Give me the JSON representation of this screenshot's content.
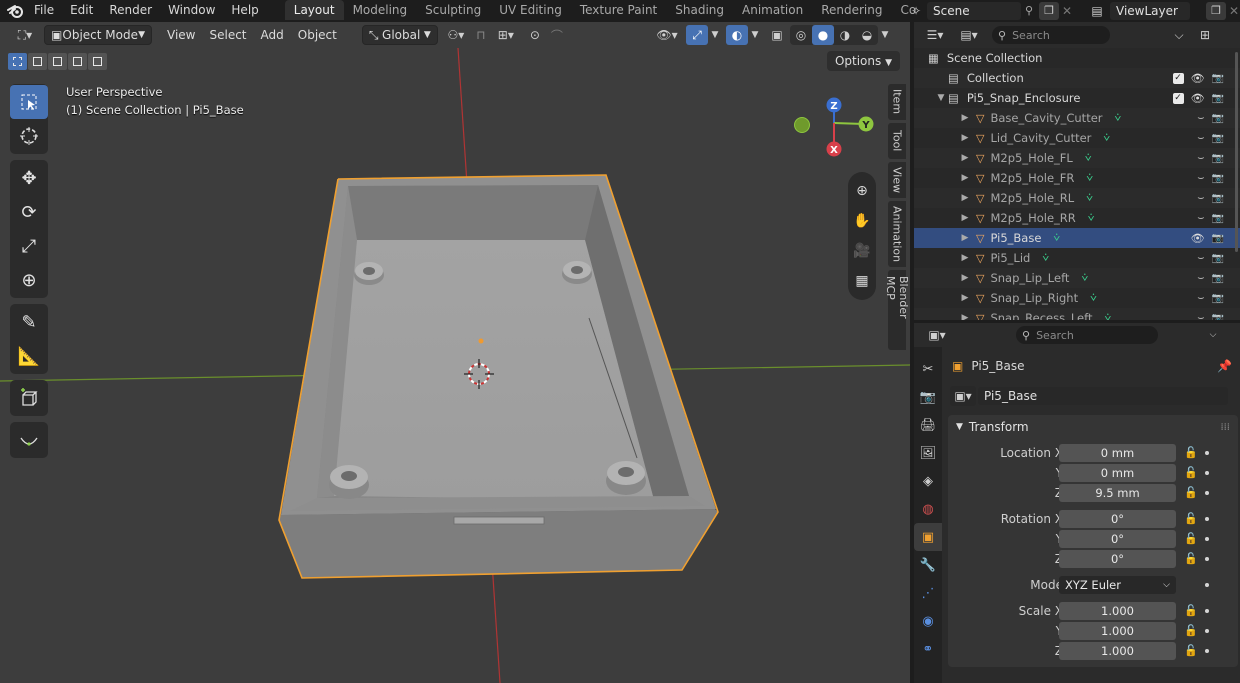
{
  "topbar": {
    "menus": [
      "File",
      "Edit",
      "Render",
      "Window",
      "Help"
    ],
    "workspaces": [
      {
        "label": "Layout",
        "active": true
      },
      {
        "label": "Modeling",
        "active": false
      },
      {
        "label": "Sculpting",
        "active": false
      },
      {
        "label": "UV Editing",
        "active": false
      },
      {
        "label": "Texture Paint",
        "active": false
      },
      {
        "label": "Shading",
        "active": false
      },
      {
        "label": "Animation",
        "active": false
      },
      {
        "label": "Rendering",
        "active": false
      },
      {
        "label": "Compositing",
        "active": false
      }
    ],
    "scene": "Scene",
    "view_layer": "ViewLayer"
  },
  "viewport": {
    "mode": "Object Mode",
    "menus": [
      "View",
      "Select",
      "Add",
      "Object"
    ],
    "orientation": "Global",
    "options_label": "Options",
    "perspective": "User Perspective",
    "collection_info": "(1) Scene Collection | Pi5_Base",
    "side_tabs": [
      "Item",
      "Tool",
      "View",
      "Animation",
      "Blender MCP"
    ],
    "gizmo": {
      "z": "Z",
      "y": "Y",
      "x": "X"
    },
    "accent": "#4772b3",
    "selection_outline": "#f0a030"
  },
  "outliner": {
    "search_placeholder": "Search",
    "rows": [
      {
        "label": "Scene Collection",
        "indent": 0,
        "kind": "scene",
        "checkbox": false,
        "visible": true
      },
      {
        "label": "Collection",
        "indent": 1,
        "kind": "collection",
        "checkbox": true,
        "visible": true
      },
      {
        "label": "Pi5_Snap_Enclosure",
        "indent": 1,
        "kind": "collection",
        "checkbox": true,
        "visible": true,
        "expanded": true
      },
      {
        "label": "Base_Cavity_Cutter",
        "indent": 2,
        "kind": "mesh",
        "dim": true
      },
      {
        "label": "Lid_Cavity_Cutter",
        "indent": 2,
        "kind": "mesh",
        "dim": true
      },
      {
        "label": "M2p5_Hole_FL",
        "indent": 2,
        "kind": "mesh",
        "dim": true
      },
      {
        "label": "M2p5_Hole_FR",
        "indent": 2,
        "kind": "mesh",
        "dim": true
      },
      {
        "label": "M2p5_Hole_RL",
        "indent": 2,
        "kind": "mesh",
        "dim": true
      },
      {
        "label": "M2p5_Hole_RR",
        "indent": 2,
        "kind": "mesh",
        "dim": true
      },
      {
        "label": "Pi5_Base",
        "indent": 2,
        "kind": "mesh",
        "selected": true
      },
      {
        "label": "Pi5_Lid",
        "indent": 2,
        "kind": "mesh",
        "dim": true
      },
      {
        "label": "Snap_Lip_Left",
        "indent": 2,
        "kind": "mesh",
        "dim": true
      },
      {
        "label": "Snap_Lip_Right",
        "indent": 2,
        "kind": "mesh",
        "dim": true
      },
      {
        "label": "Snap_Recess_Left",
        "indent": 2,
        "kind": "mesh",
        "dim": true
      }
    ]
  },
  "properties": {
    "search_placeholder": "Search",
    "object_name": "Pi5_Base",
    "data_name": "Pi5_Base",
    "panel_title": "Transform",
    "location": {
      "label": "Location X",
      "x": "0 mm",
      "y": "0 mm",
      "z": "9.5 mm"
    },
    "rotation": {
      "label": "Rotation X",
      "x": "0°",
      "y": "0°",
      "z": "0°"
    },
    "mode": {
      "label": "Mode",
      "value": "XYZ Euler"
    },
    "scale": {
      "label": "Scale X",
      "x": "1.000",
      "y": "1.000",
      "z": "1.000"
    },
    "axis_y": "Y",
    "axis_z": "Z"
  }
}
